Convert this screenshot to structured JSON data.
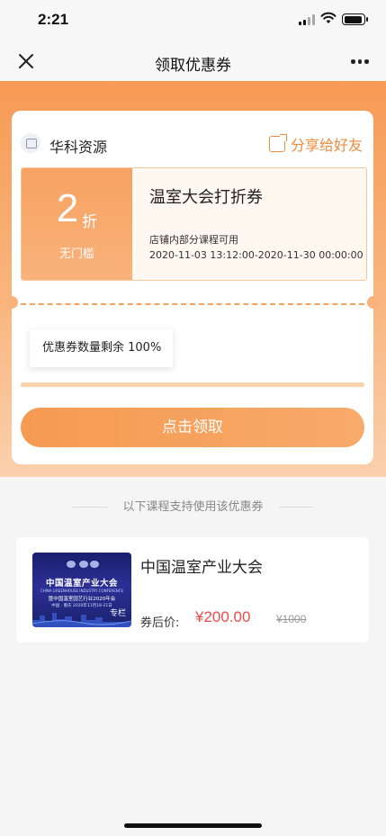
{
  "status_bar": {
    "time": "2:21"
  },
  "nav": {
    "title": "领取优惠券"
  },
  "shop": {
    "name": "华科资源",
    "share_label": "分享给好友"
  },
  "coupon": {
    "discount_value": "2",
    "discount_unit": "折",
    "threshold": "无门槛",
    "name": "温室大会打折券",
    "scope": "店铺内部分课程可用",
    "valid_period": "2020-11-03 13:12:00-2020-11-30 00:00:00",
    "remaining_text": "优惠券数量剩余 100%",
    "remaining_fraction": 1.0
  },
  "claim_button": {
    "label": "点击领取"
  },
  "section": {
    "supported_courses_label": "以下课程支持使用该优惠券"
  },
  "course": {
    "title": "中国温室产业大会",
    "price_label": "券后价:",
    "price": "¥200.00",
    "original_price": "¥1000",
    "thumbnail": {
      "line1": "中国温室产业大会",
      "line2": "CHINA GREENHOUSE INDUSTRY CONFERENCE",
      "line3": "暨中国温室园艺行业2020年会",
      "line4": "中国 · 重庆   2020年11月18-21日",
      "badge": "专栏"
    }
  },
  "colors": {
    "accent": "#F59A52",
    "price_red": "#EF4A4A",
    "share_orange": "#EE8A3C"
  },
  "icons": {
    "close": "close-icon",
    "more": "more-icon",
    "shop": "shop-icon",
    "share": "share-icon"
  }
}
